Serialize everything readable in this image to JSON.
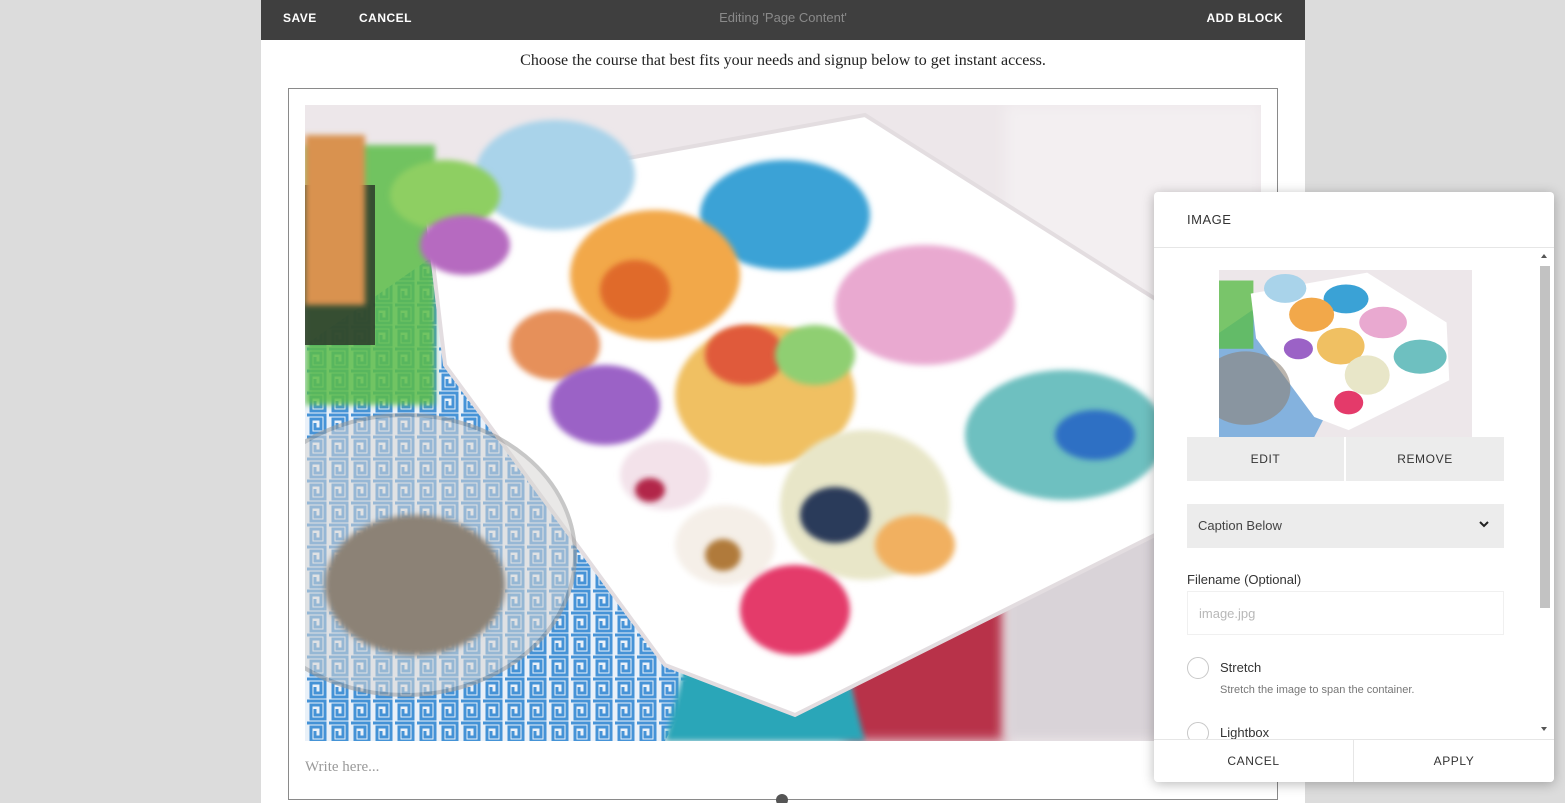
{
  "toolbar": {
    "save_label": "SAVE",
    "cancel_label": "CANCEL",
    "title": "Editing 'Page Content'",
    "add_block_label": "ADD BLOCK"
  },
  "content": {
    "intro_text": "Choose the course that best fits your needs and signup below to get instant access.",
    "caption_placeholder": "Write here..."
  },
  "image_panel": {
    "title": "IMAGE",
    "edit_label": "EDIT",
    "remove_label": "REMOVE",
    "caption_select_value": "Caption Below",
    "filename_label": "Filename (Optional)",
    "filename_placeholder": "image.jpg",
    "filename_value": "",
    "options": [
      {
        "label": "Stretch",
        "description": "Stretch the image to span the container.",
        "checked": false
      },
      {
        "label": "Lightbox",
        "description": "",
        "checked": false
      }
    ],
    "cancel_label": "CANCEL",
    "apply_label": "APPLY"
  },
  "colors": {
    "toolbar_bg": "#3f3f3f",
    "page_bg": "#dcdcdc",
    "button_bg": "#ececec"
  }
}
